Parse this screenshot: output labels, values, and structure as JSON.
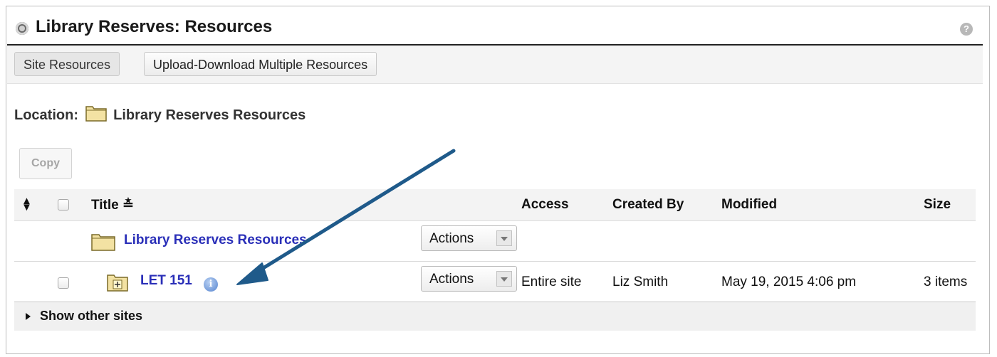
{
  "tool": {
    "title": "Library Reserves: Resources",
    "help_icon": "help-icon"
  },
  "nav": {
    "site_resources": "Site Resources",
    "upload_download": "Upload-Download Multiple Resources"
  },
  "location": {
    "label": "Location:",
    "folder": "Library Reserves Resources"
  },
  "copy_button": "Copy",
  "table": {
    "headers": {
      "title": "Title",
      "title_sort": "≛",
      "access": "Access",
      "created_by": "Created By",
      "modified": "Modified",
      "size": "Size"
    },
    "folder_row": {
      "title": "Library Reserves Resources",
      "actions": "Actions"
    },
    "item_row": {
      "title": "LET 151",
      "info": "i",
      "actions": "Actions",
      "access": "Entire site",
      "created_by": "Liz Smith",
      "modified": "May 19, 2015 4:06 pm",
      "size": "3 items"
    }
  },
  "show_other_sites": "Show other sites",
  "annotation": {
    "arrow_color": "#1f5a8a"
  }
}
